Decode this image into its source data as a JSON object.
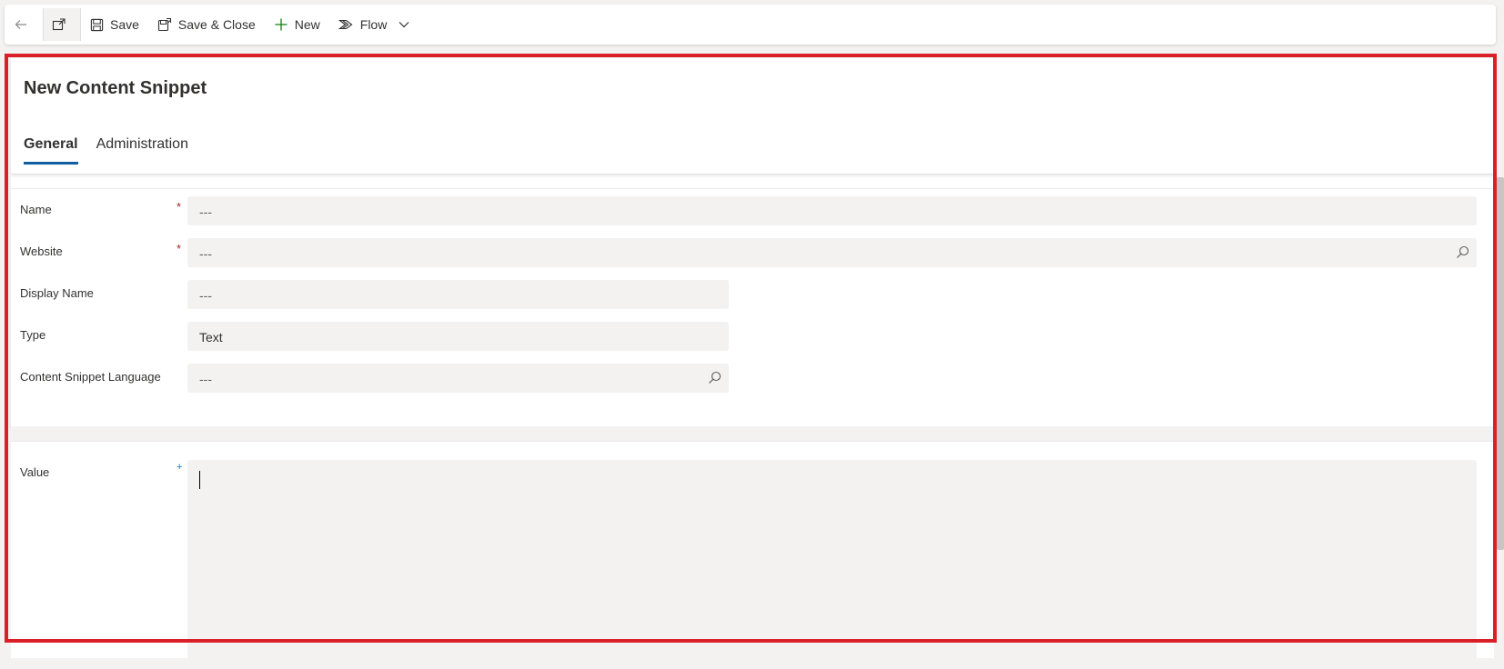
{
  "toolbar": {
    "back_icon": "back-arrow-icon",
    "popout_icon": "open-in-new-window-icon",
    "save_label": "Save",
    "save_close_label": "Save & Close",
    "new_label": "New",
    "flow_label": "Flow"
  },
  "form": {
    "title": "New Content Snippet",
    "tabs": [
      {
        "label": "General",
        "active": true
      },
      {
        "label": "Administration",
        "active": false
      }
    ],
    "fields": {
      "name": {
        "label": "Name",
        "required": "*",
        "value": "---"
      },
      "website": {
        "label": "Website",
        "required": "*",
        "value": "---"
      },
      "display_name": {
        "label": "Display Name",
        "value": "---"
      },
      "type": {
        "label": "Type",
        "value": "Text"
      },
      "language": {
        "label": "Content Snippet Language",
        "value": "---"
      },
      "value": {
        "label": "Value",
        "recommended": "+",
        "value": ""
      }
    }
  },
  "colors": {
    "accent": "#115ea3",
    "required": "#a4262c",
    "highlight_border": "#d92028",
    "field_bg": "#f3f2f1"
  }
}
